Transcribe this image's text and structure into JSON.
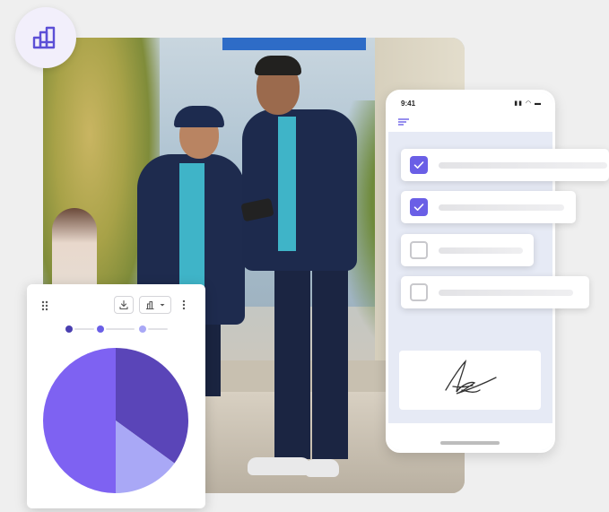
{
  "phone": {
    "time": "9:41",
    "checklist": [
      {
        "checked": true
      },
      {
        "checked": true
      },
      {
        "checked": false
      },
      {
        "checked": false
      }
    ]
  },
  "icons": {
    "logo": "bar-chart-icon",
    "menu": "menu-icon",
    "drag": "drag-handle-icon",
    "download": "download-icon",
    "chart_type": "chart-type-icon",
    "more": "more-vertical-icon",
    "signature": "signature-icon"
  },
  "colors": {
    "accent": "#6a5fe6",
    "pie_dark": "#5a45b8",
    "pie_main": "#7e62f2",
    "pie_light": "#a9a8f6"
  },
  "chart_data": {
    "type": "pie",
    "values": [
      0.35,
      0.15,
      0.5
    ],
    "colors": [
      "#5a45b8",
      "#a9a8f6",
      "#7e62f2"
    ],
    "legend": "top"
  }
}
